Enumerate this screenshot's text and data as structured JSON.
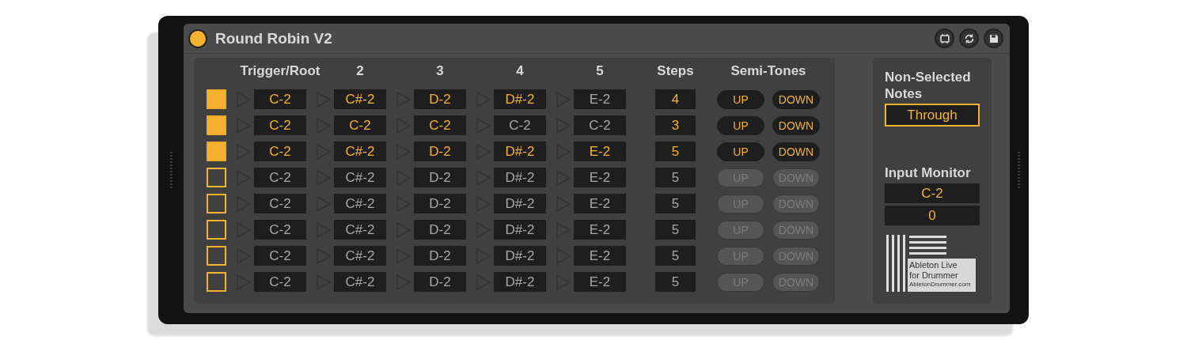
{
  "window": {
    "title": "Round Robin V2",
    "on": true
  },
  "columns": [
    "Trigger/Root",
    "2",
    "3",
    "4",
    "5"
  ],
  "steps_header": "Steps",
  "semitones_header": "Semi-Tones",
  "rows": [
    {
      "checked": true,
      "notes": [
        {
          "text": "C-2",
          "active": true
        },
        {
          "text": "C#-2",
          "active": true
        },
        {
          "text": "D-2",
          "active": true
        },
        {
          "text": "D#-2",
          "active": true
        },
        {
          "text": "E-2",
          "active": false
        }
      ],
      "steps": "4",
      "up": "UP",
      "down": "DOWN"
    },
    {
      "checked": true,
      "notes": [
        {
          "text": "C-2",
          "active": true
        },
        {
          "text": "C-2",
          "active": true
        },
        {
          "text": "C-2",
          "active": true
        },
        {
          "text": "C-2",
          "active": false
        },
        {
          "text": "C-2",
          "active": false
        }
      ],
      "steps": "3",
      "up": "UP",
      "down": "DOWN"
    },
    {
      "checked": true,
      "notes": [
        {
          "text": "C-2",
          "active": true
        },
        {
          "text": "C#-2",
          "active": true
        },
        {
          "text": "D-2",
          "active": true
        },
        {
          "text": "D#-2",
          "active": true
        },
        {
          "text": "E-2",
          "active": true
        }
      ],
      "steps": "5",
      "up": "UP",
      "down": "DOWN"
    },
    {
      "checked": false,
      "notes": [
        {
          "text": "C-2",
          "active": false
        },
        {
          "text": "C#-2",
          "active": false
        },
        {
          "text": "D-2",
          "active": false
        },
        {
          "text": "D#-2",
          "active": false
        },
        {
          "text": "E-2",
          "active": false
        }
      ],
      "steps": "5",
      "up": "UP",
      "down": "DOWN"
    },
    {
      "checked": false,
      "notes": [
        {
          "text": "C-2",
          "active": false
        },
        {
          "text": "C#-2",
          "active": false
        },
        {
          "text": "D-2",
          "active": false
        },
        {
          "text": "D#-2",
          "active": false
        },
        {
          "text": "E-2",
          "active": false
        }
      ],
      "steps": "5",
      "up": "UP",
      "down": "DOWN"
    },
    {
      "checked": false,
      "notes": [
        {
          "text": "C-2",
          "active": false
        },
        {
          "text": "C#-2",
          "active": false
        },
        {
          "text": "D-2",
          "active": false
        },
        {
          "text": "D#-2",
          "active": false
        },
        {
          "text": "E-2",
          "active": false
        }
      ],
      "steps": "5",
      "up": "UP",
      "down": "DOWN"
    },
    {
      "checked": false,
      "notes": [
        {
          "text": "C-2",
          "active": false
        },
        {
          "text": "C#-2",
          "active": false
        },
        {
          "text": "D-2",
          "active": false
        },
        {
          "text": "D#-2",
          "active": false
        },
        {
          "text": "E-2",
          "active": false
        }
      ],
      "steps": "5",
      "up": "UP",
      "down": "DOWN"
    },
    {
      "checked": false,
      "notes": [
        {
          "text": "C-2",
          "active": false
        },
        {
          "text": "C#-2",
          "active": false
        },
        {
          "text": "D-2",
          "active": false
        },
        {
          "text": "D#-2",
          "active": false
        },
        {
          "text": "E-2",
          "active": false
        }
      ],
      "steps": "5",
      "up": "UP",
      "down": "DOWN"
    }
  ],
  "non_selected": {
    "label": "Non-Selected Notes",
    "value": "Through"
  },
  "input_monitor": {
    "label": "Input Monitor",
    "note": "C-2",
    "value": "0"
  },
  "logo": {
    "name": "Ableton Live for Drummer",
    "url": "AbletonDrummer.com"
  }
}
